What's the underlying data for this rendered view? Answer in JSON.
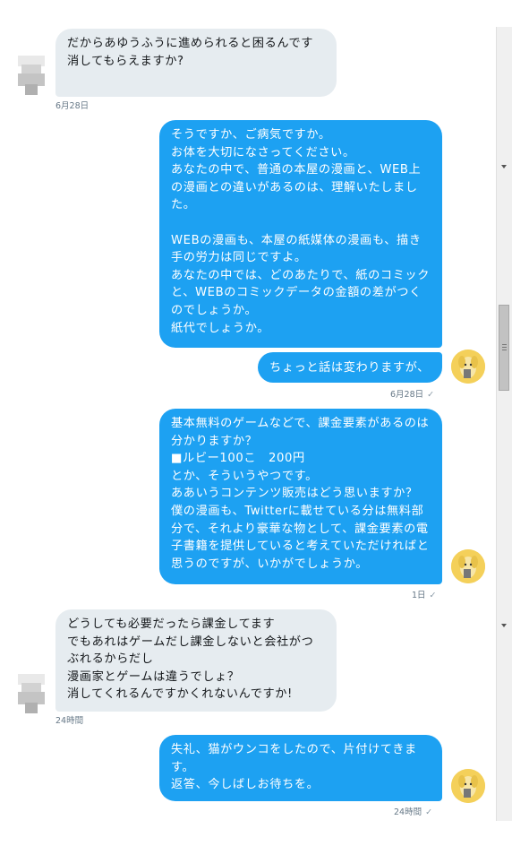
{
  "messages": [
    {
      "id": "m1",
      "text": "だからあゆうふうに進められると困るんです\n消してもらえますか?"
    },
    {
      "id": "m2",
      "text": "そうですか、ご病気ですか。\nお体を大切になさってください。\nあなたの中で、普通の本屋の漫画と、WEB上の漫画との違いがあるのは、理解いたしました。\n\nWEBの漫画も、本屋の紙媒体の漫画も、描き手の労力は同じですよ。\nあなたの中では、どのあたりで、紙のコミックと、WEBのコミックデータの金額の差がつくのでしょうか。\n紙代でしょうか。"
    },
    {
      "id": "m3",
      "text": "ちょっと話は変わりますが、"
    },
    {
      "id": "m4",
      "text": "基本無料のゲームなどで、課金要素があるのは分かりますか？\n■ルビー100こ　200円\nとか、そういうやつです。\nああいうコンテンツ販売はどう思いますか？\n僕の漫画も、Twitterに載せている分は無料部分で、それより豪華な物として、課金要素の電子書籍を提供していると考えていただければと思うのですが、いかがでしょうか。"
    },
    {
      "id": "m5",
      "text": "どうしても必要だったら課金してます\nでもあれはゲームだし課金しないと会社がつぶれるからだし\n漫画家とゲームは違うでしょ？\n消してくれるんですかくれないんですか!"
    },
    {
      "id": "m6",
      "text": "失礼、猫がウンコをしたので、片付けてきます。\n返答、今しばしお待ちを。"
    }
  ],
  "timestamps": {
    "t1": "6月28日",
    "t2": "6月28日",
    "t3": "1日",
    "t4": "24時間",
    "t5": "24時間"
  },
  "icons": {
    "read_check": "✓"
  },
  "colors": {
    "outgoing": "#1da1f2",
    "incoming": "#e6ecf0",
    "timestamp": "#657786"
  }
}
